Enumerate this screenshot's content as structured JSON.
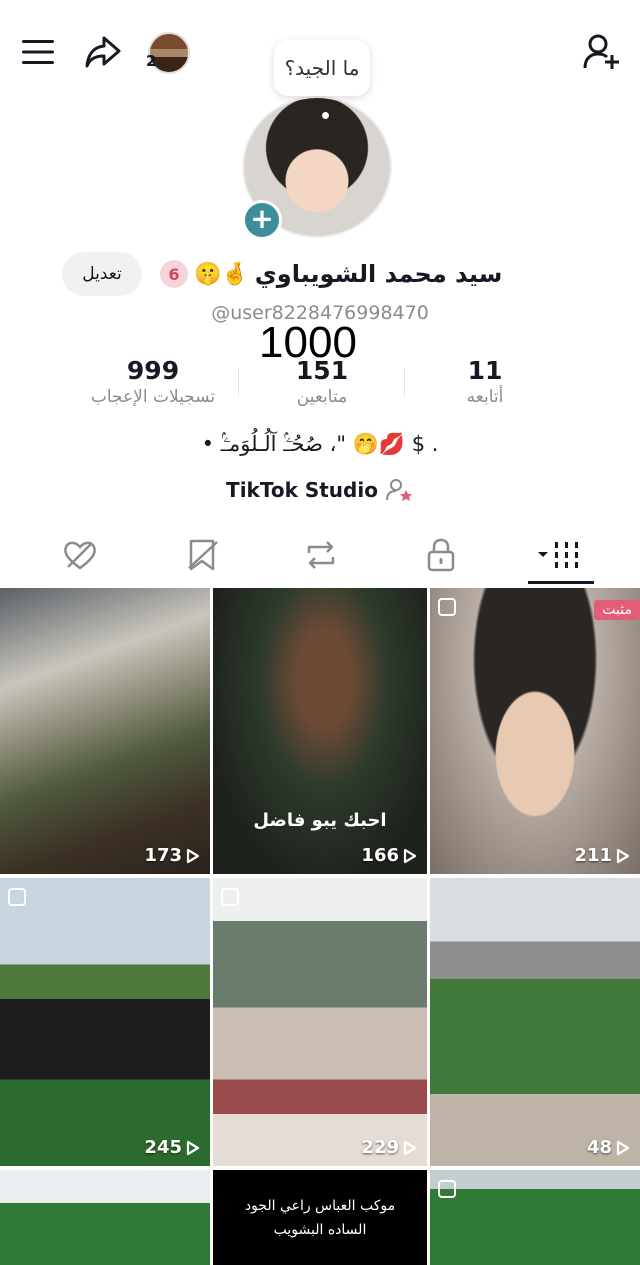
{
  "topbar": {
    "notification_count": "2",
    "menu_icon": "hamburger-menu-icon",
    "share_icon": "share-arrow-icon",
    "add_friend_icon": "add-user-icon"
  },
  "profile": {
    "bubble_text": "ما الجيد؟",
    "edit_label": "تعديل",
    "badge_count": "6",
    "emojis": "🤫🤞",
    "name": "سيد محمد الشويباوي",
    "username": "@user8228476998470",
    "overlay_number": "1000"
  },
  "stats": {
    "likes_value": "999",
    "likes_label": "تسجيلات الإعجاب",
    "followers_value": "151",
    "followers_label": "متابعين",
    "following_value": "11",
    "following_label": "أتابعه"
  },
  "bio": "• صُحُـۧـۢ آلُـلُوَمـۧـۢ ،\" 🤭💋 $ .",
  "studio": {
    "label": "TikTok Studio"
  },
  "tabs": [
    {
      "icon": "liked-hidden-icon"
    },
    {
      "icon": "favorites-hidden-icon"
    },
    {
      "icon": "repost-icon"
    },
    {
      "icon": "lock-icon"
    },
    {
      "icon": "videos-grid-icon"
    }
  ],
  "videos": [
    {
      "views": "173",
      "pinned": false
    },
    {
      "views": "166",
      "pinned": false,
      "caption": "احبك يبو فاضل"
    },
    {
      "views": "211",
      "pinned": true,
      "pinned_label": "مثبت"
    },
    {
      "views": "245",
      "pinned": false
    },
    {
      "views": "229",
      "pinned": false
    },
    {
      "views": "48",
      "pinned": false
    },
    {
      "views": "",
      "pinned": false
    },
    {
      "views": "",
      "pinned": false,
      "caption_line1": "موكب العباس راعي الجود",
      "caption_line2": "الساده البشويب"
    },
    {
      "views": "",
      "pinned": false
    }
  ],
  "colors": {
    "accent_pink": "#e35d76",
    "plus_teal": "#3e8d9b",
    "muted_text": "#8a8b91"
  }
}
